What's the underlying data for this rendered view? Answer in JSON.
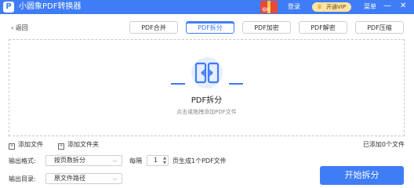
{
  "titlebar": {
    "app_title": "小圆象PDF转换器",
    "gift_label": "福利",
    "login": "登录",
    "vip": "开通VIP",
    "menu": "菜单",
    "minimize": "—",
    "close": "✕"
  },
  "nav": {
    "back": "返回"
  },
  "tabs": [
    {
      "label": "PDF合并"
    },
    {
      "label": "PDF拆分",
      "active": true
    },
    {
      "label": "PDF加密"
    },
    {
      "label": "PDF解密"
    },
    {
      "label": "PDF压缩"
    }
  ],
  "dropzone": {
    "title": "PDF拆分",
    "hint": "点击或拖拽添加PDF文件"
  },
  "files": {
    "add_file": "添加文件",
    "add_folder": "添加文件夹",
    "added_count": "已添加0个文件"
  },
  "options": {
    "format_label": "输出格式:",
    "format_value": "按页数拆分",
    "every_label": "每隔",
    "every_value": "1",
    "every_suffix": "页生成1个PDF文件",
    "dir_label": "输出目录:",
    "dir_value": "原文件路径"
  },
  "action": {
    "start": "开始拆分"
  },
  "colors": {
    "accent": "#3f7df6",
    "vip_bg": "#fde4a6"
  }
}
